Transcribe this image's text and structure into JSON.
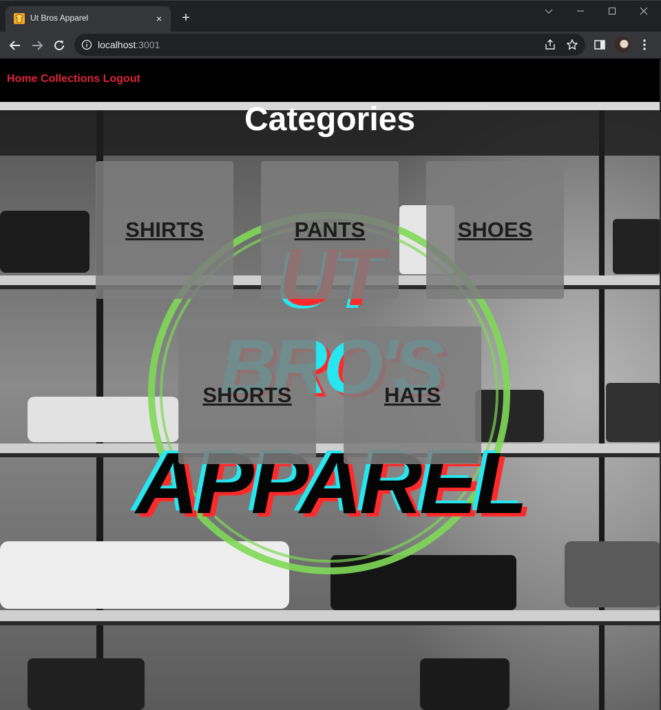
{
  "browser": {
    "tab_title": "Ut Bros Apparel",
    "tab_close": "×",
    "new_tab": "+",
    "url_host": "localhost",
    "url_port": ":3001"
  },
  "nav": {
    "home": "Home",
    "collections": "Collections",
    "logout": "Logout"
  },
  "page": {
    "title": "Categories",
    "categories": [
      {
        "label": "SHIRTS"
      },
      {
        "label": "PANTS"
      },
      {
        "label": "SHOES"
      },
      {
        "label": "SHORTS"
      },
      {
        "label": "HATS"
      }
    ]
  },
  "logo": {
    "line1": "UT",
    "line2": "BRO'S",
    "line3": "APPAREL"
  },
  "colors": {
    "nav_link": "#e0243a",
    "logo_red": "#ff2a2a",
    "logo_cyan": "#27e6f0",
    "logo_ring": "#7ed957"
  },
  "icons": [
    "favicon-shirt-icon",
    "close-icon",
    "plus-icon",
    "chevron-down-icon",
    "minimize-icon",
    "maximize-icon",
    "window-close-icon",
    "back-arrow-icon",
    "forward-arrow-icon",
    "reload-icon",
    "info-icon",
    "share-icon",
    "star-icon",
    "side-panel-icon",
    "kebab-menu-icon"
  ]
}
